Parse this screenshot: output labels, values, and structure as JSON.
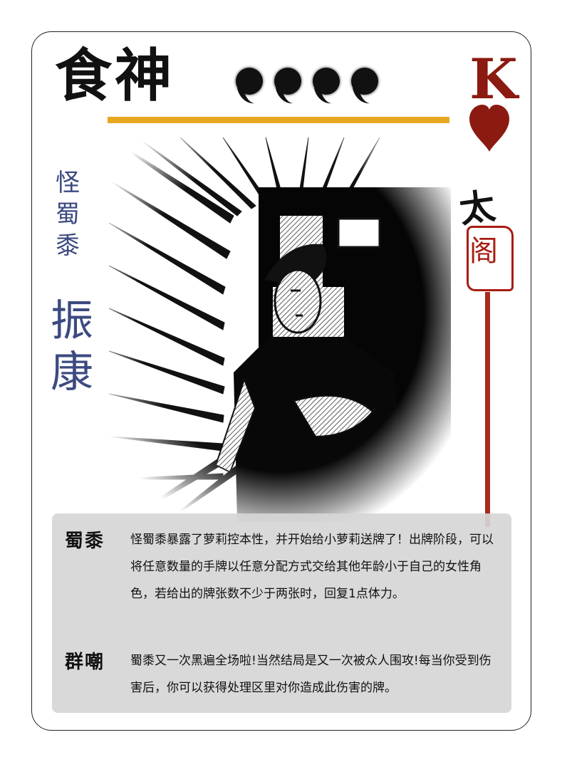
{
  "card": {
    "title": "食神",
    "hp_count": 4,
    "rank": "K",
    "suit": "heart-suit",
    "faction": {
      "char": "太",
      "seal": "阁"
    },
    "character": {
      "subtitle": [
        "怪",
        "蜀",
        "黍"
      ],
      "name": [
        "振",
        "康"
      ]
    },
    "colors": {
      "gold": "#e6a723",
      "red": "#8b1a10",
      "blue": "#3c4a80",
      "panel": "#d6d6d6"
    },
    "skills": [
      {
        "name": "蜀黍",
        "text": "怪蜀黍暴露了萝莉控本性，并开始给小萝莉送牌了！出牌阶段，可以将任意数量的手牌以任意分配方式交给其他年龄小于自己的女性角色，若给出的牌张数不少于两张时，回复1点体力。"
      },
      {
        "name": "群嘲",
        "text": "蜀黍又一次黑遍全场啦!当然结局是又一次被众人围攻!每当你受到伤害后，你可以获得处理区里对你造成此伤害的牌。"
      }
    ]
  }
}
